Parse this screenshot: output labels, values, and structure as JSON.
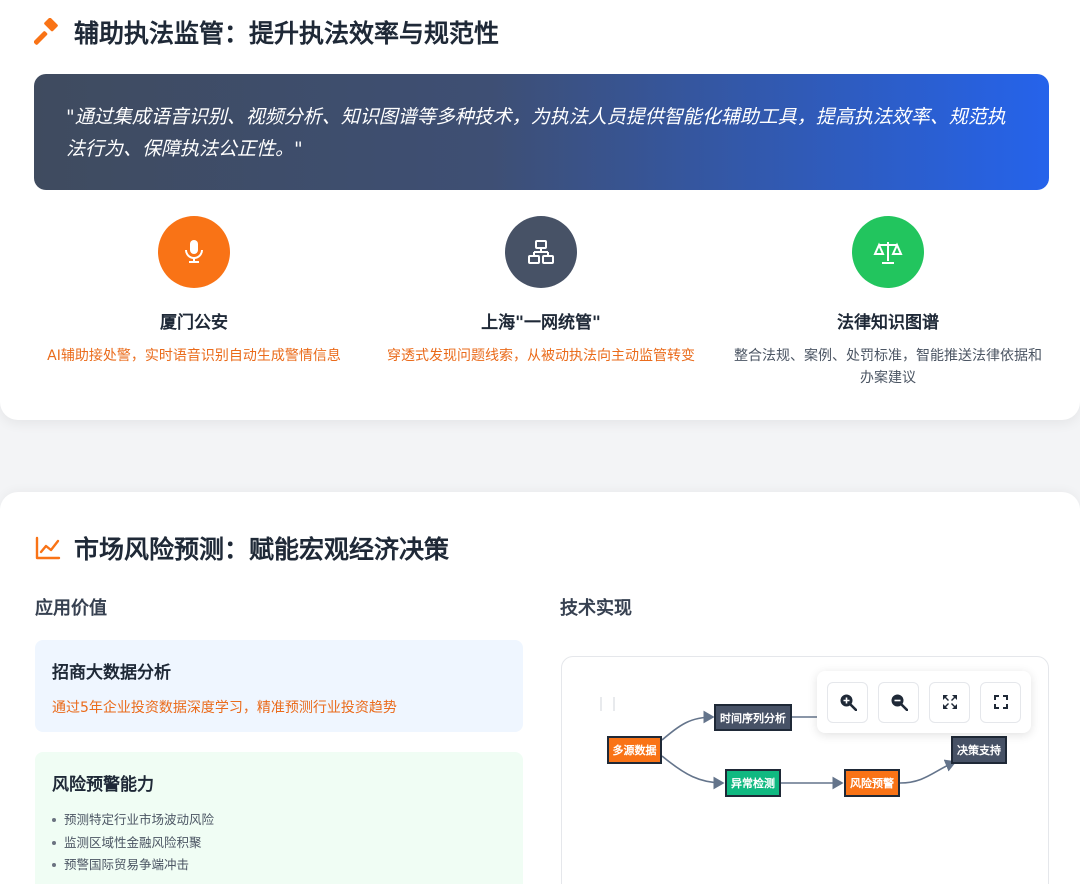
{
  "section1": {
    "title": "辅助执法监管：提升执法效率与规范性",
    "quote": "\"通过集成语音识别、视频分析、知识图谱等多种技术，为执法人员提供智能化辅助工具，提高执法效率、规范执法行为、保障执法公正性。\"",
    "features": [
      {
        "title": "厦门公安",
        "desc": "AI辅助接处警，实时语音识别自动生成警情信息",
        "icon": "microphone-icon",
        "color": "#f97316",
        "text_color": "#ea6b1b"
      },
      {
        "title": "上海\"一网统管\"",
        "desc": "穿透式发现问题线索，从被动执法向主动监管转变",
        "icon": "network-icon",
        "color": "#475266",
        "text_color": "#ea6b1b"
      },
      {
        "title": "法律知识图谱",
        "desc": "整合法规、案例、处罚标准，智能推送法律依据和办案建议",
        "icon": "balance-scale-icon",
        "color": "#22c55e",
        "text_color": "#4b5563"
      }
    ]
  },
  "section2": {
    "title": "市场风险预测：赋能宏观经济决策",
    "left_heading": "应用价值",
    "right_heading": "技术实现",
    "cards": [
      {
        "title": "招商大数据分析",
        "desc": "通过5年企业投资数据深度学习，精准预测行业投资趋势"
      },
      {
        "title": "风险预警能力",
        "bullets": [
          "预测特定行业市场波动风险",
          "监测区域性金融风险积聚",
          "预警国际贸易争端冲击"
        ]
      }
    ],
    "diagram": {
      "nodes": {
        "source": "多源数据",
        "time_series": "时间序列分析",
        "anomaly": "异常检测",
        "warning": "风险预警",
        "decision": "决策支持"
      },
      "tools": [
        "zoom-in-icon",
        "zoom-out-icon",
        "fit-view-icon",
        "fullscreen-icon"
      ]
    }
  },
  "colors": {
    "accent": "#f97316",
    "dark": "#475266",
    "green": "#22c55e",
    "blue": "#2563eb"
  }
}
